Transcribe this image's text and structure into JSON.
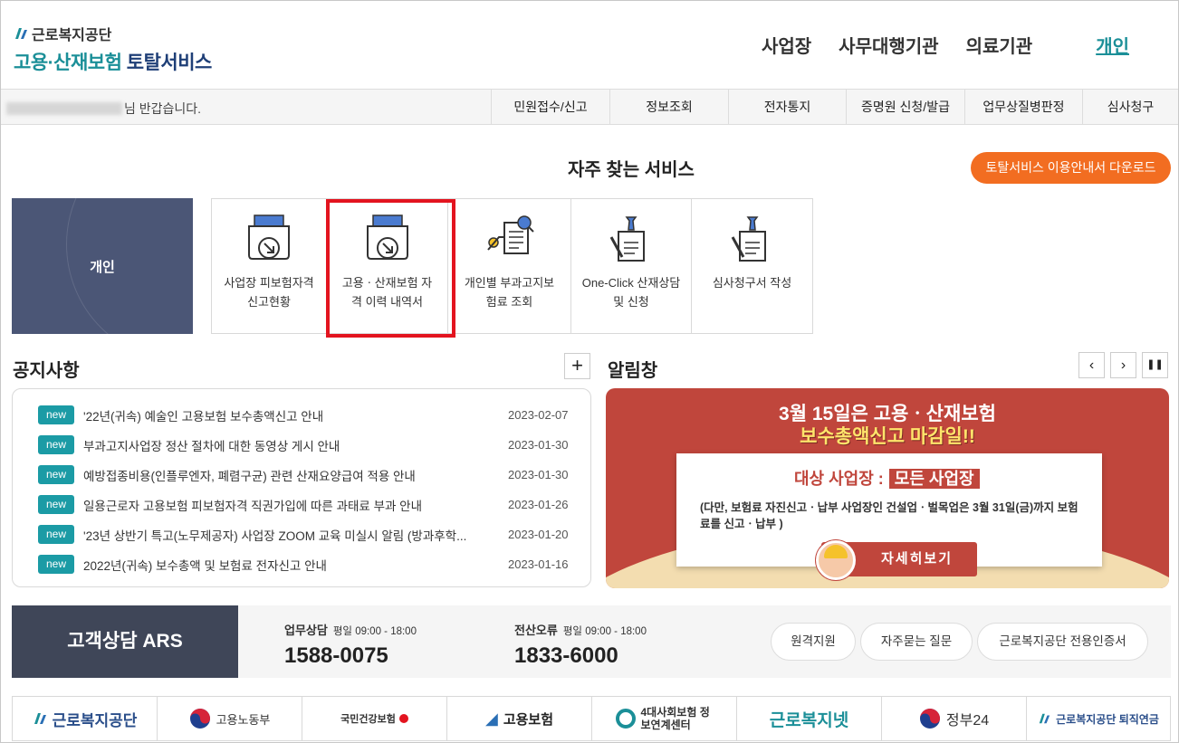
{
  "header": {
    "org_name": "근로복지공단",
    "service_name_teal": "고용·산재보험",
    "service_name_suffix": " 토탈서비스",
    "nav": [
      "사업장",
      "사무대행기관",
      "의료기관"
    ],
    "nav_active": "개인"
  },
  "subbar": {
    "greeting": "님 반갑습니다.",
    "menu": [
      "민원접수/신고",
      "정보조회",
      "전자통지",
      "증명원 신청/발급",
      "업무상질병판정",
      "심사청구"
    ]
  },
  "frequent": {
    "title": "자주 찾는 서비스",
    "download_label": "토탈서비스 이용안내서 다운로드",
    "personal_label": "개인",
    "items": [
      {
        "line1": "사업장 피보험자격",
        "line2": "신고현황",
        "icon": "document-tray-icon"
      },
      {
        "line1": "고용ㆍ산재보험 자",
        "line2": "격 이력 내역서",
        "icon": "document-tray-icon"
      },
      {
        "line1": "개인별 부과고지보",
        "line2": "험료 조회",
        "icon": "document-search-icon"
      },
      {
        "line1": "One-Click 산재상담",
        "line2": "및 신청",
        "icon": "document-pen-icon"
      },
      {
        "line1": "심사청구서 작성",
        "line2": "",
        "icon": "document-pen-icon"
      }
    ]
  },
  "notices": {
    "title": "공지사항",
    "more": "+",
    "badge": "new",
    "items": [
      {
        "title": "'22년(귀속) 예술인 고용보험 보수총액신고 안내",
        "date": "2023-02-07"
      },
      {
        "title": "부과고지사업장 정산 절차에 대한 동영상 게시 안내",
        "date": "2023-01-30"
      },
      {
        "title": "예방접종비용(인플루엔자, 폐렴구균) 관련 산재요양급여 적용 안내",
        "date": "2023-01-30"
      },
      {
        "title": "일용근로자 고용보험 피보험자격 직권가입에 따른 과태료 부과 안내",
        "date": "2023-01-26"
      },
      {
        "title": "'23년 상반기 특고(노무제공자) 사업장 ZOOM 교육 미실시 알림 (방과후학...",
        "date": "2023-01-20"
      },
      {
        "title": "2022년(귀속) 보수총액 및 보험료 전자신고 안내",
        "date": "2023-01-16"
      }
    ]
  },
  "alerts": {
    "title": "알림창",
    "prev": "‹",
    "next": "›",
    "pause": "❚❚",
    "banner_line1": "3월 15일은 고용ㆍ산재보험",
    "banner_line2": "보수총액신고 마감일!!",
    "target_label": "대상 사업장 :",
    "target_value": "모든 사업장",
    "desc": "(다만, 보험료 자진신고ㆍ납부 사업장인 건설업ㆍ벌목업은 3월 31일(금)까지 보험료를 신고ㆍ납부 )",
    "more_label": "자세히보기"
  },
  "customer": {
    "title": "고객상담 ARS",
    "business_label": "업무상담",
    "business_hours": "평일 09:00 - 18:00",
    "business_number": "1588-0075",
    "error_label": "전산오류",
    "error_hours": "평일 09:00 - 18:00",
    "error_number": "1833-6000",
    "buttons": [
      "원격지원",
      "자주묻는 질문",
      "근로복지공단 전용인증서"
    ]
  },
  "footer": {
    "links": [
      "근로복지공단",
      "고용노동부",
      "국민건강보험",
      "고용보험",
      "4대사회보험 정보연계센터",
      "근로복지넷",
      "정부24",
      "근로복지공단 퇴직연금"
    ]
  }
}
